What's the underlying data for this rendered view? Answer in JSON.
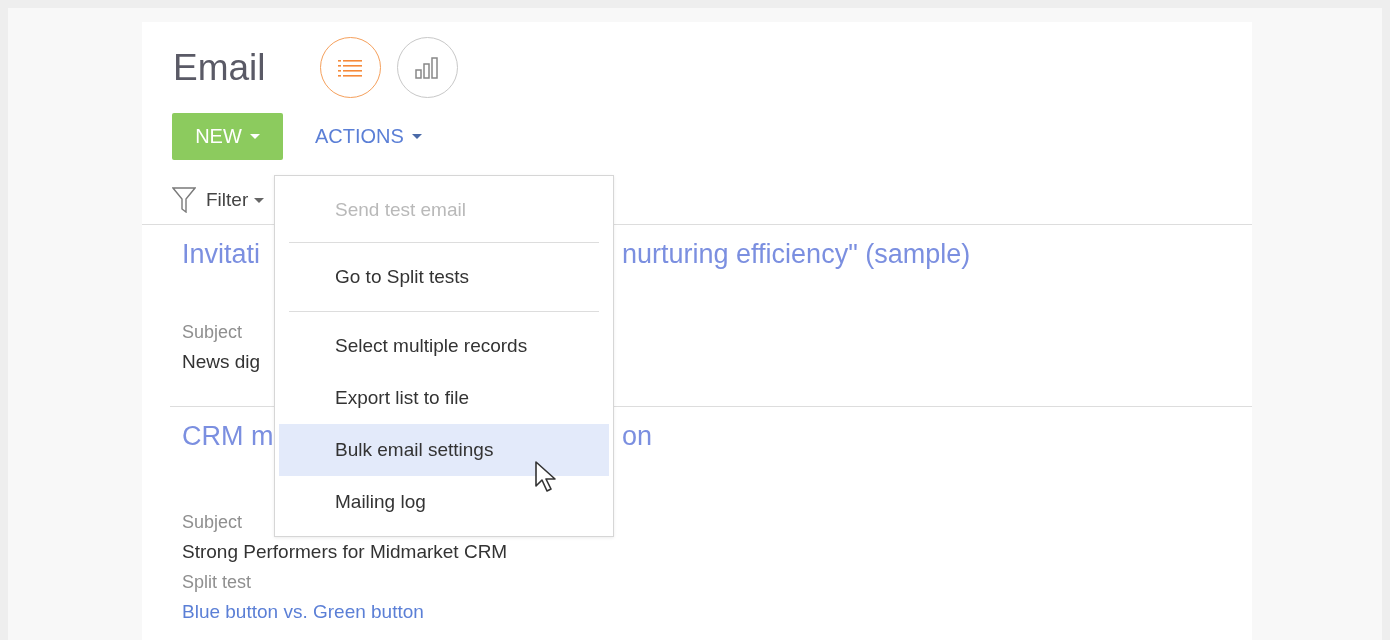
{
  "page": {
    "title": "Email"
  },
  "view_buttons": [
    {
      "kind": "list",
      "selected": true
    },
    {
      "kind": "chart",
      "selected": false
    }
  ],
  "toolbar": {
    "new_button": "NEW",
    "actions_button": "ACTIONS",
    "filter": "Filter"
  },
  "records": [
    {
      "title_start": "Invitati",
      "title_end": "nurturing efficiency\" (sample)",
      "fields": [
        {
          "label": "Subject",
          "value": "News dig",
          "kind": "text"
        }
      ]
    },
    {
      "title_start": "CRM m",
      "title_end": "on",
      "fields": [
        {
          "label": "Subject",
          "value": "Strong Performers for Midmarket CRM",
          "kind": "text"
        },
        {
          "label": "Split test",
          "value": "Blue button vs. Green button",
          "kind": "link"
        }
      ]
    }
  ],
  "actions_menu": [
    {
      "label": "Send test email",
      "disabled": true,
      "selected": false,
      "divider_after": true
    },
    {
      "label": "Go to Split tests",
      "disabled": false,
      "selected": false,
      "divider_after": true
    },
    {
      "label": "Select multiple records",
      "disabled": false,
      "selected": false,
      "divider_after": false
    },
    {
      "label": "Export list to file",
      "disabled": false,
      "selected": false,
      "divider_after": false
    },
    {
      "label": "Bulk email settings",
      "disabled": false,
      "selected": true,
      "divider_after": false
    },
    {
      "label": "Mailing log",
      "disabled": false,
      "selected": false,
      "divider_after": false
    }
  ]
}
